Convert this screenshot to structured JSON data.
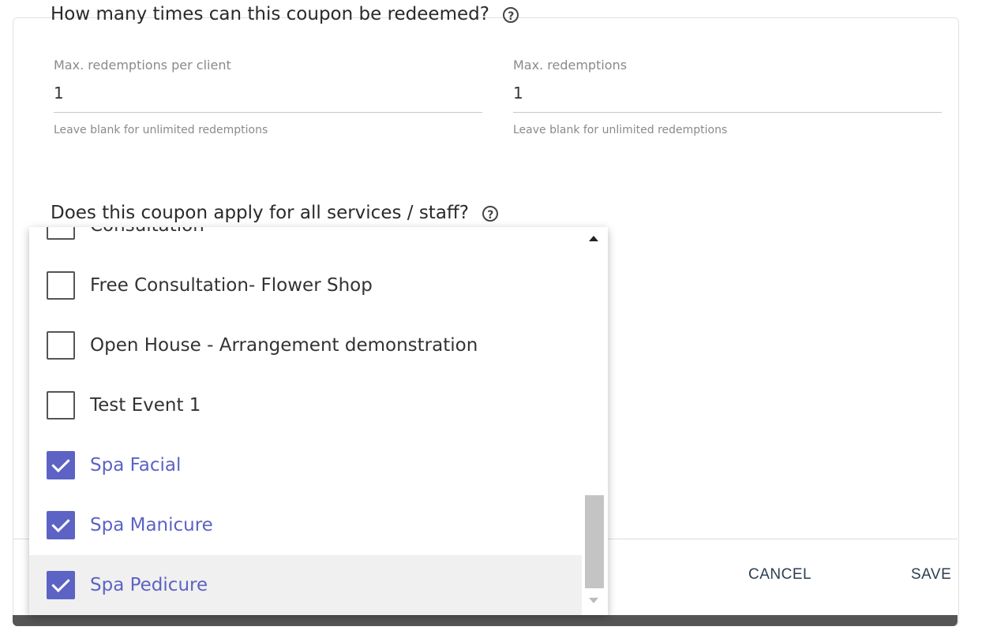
{
  "sections": {
    "redemption_title": "How many times can this coupon be redeemed?",
    "applies_title": "Does this coupon apply for all services / staff?",
    "help_glyph": "?"
  },
  "fields": {
    "per_client": {
      "label": "Max. redemptions per client",
      "value": "1",
      "hint": "Leave blank for unlimited redemptions"
    },
    "total": {
      "label": "Max. redemptions",
      "value": "1",
      "hint": "Leave blank for unlimited redemptions"
    }
  },
  "dropdown": {
    "items": [
      {
        "label": "Consultation",
        "checked": false
      },
      {
        "label": "Free Consultation- Flower Shop",
        "checked": false
      },
      {
        "label": "Open House - Arrangement demonstration",
        "checked": false
      },
      {
        "label": "Test Event 1",
        "checked": false
      },
      {
        "label": "Spa Facial",
        "checked": true
      },
      {
        "label": "Spa Manicure",
        "checked": true
      },
      {
        "label": "Spa Pedicure",
        "checked": true
      }
    ],
    "highlighted_index": 6
  },
  "footer": {
    "cancel_label": "CANCEL",
    "save_label": "SAVE"
  },
  "colors": {
    "accent": "#5c63c4",
    "text": "#333333",
    "muted": "#8a8a8a"
  }
}
